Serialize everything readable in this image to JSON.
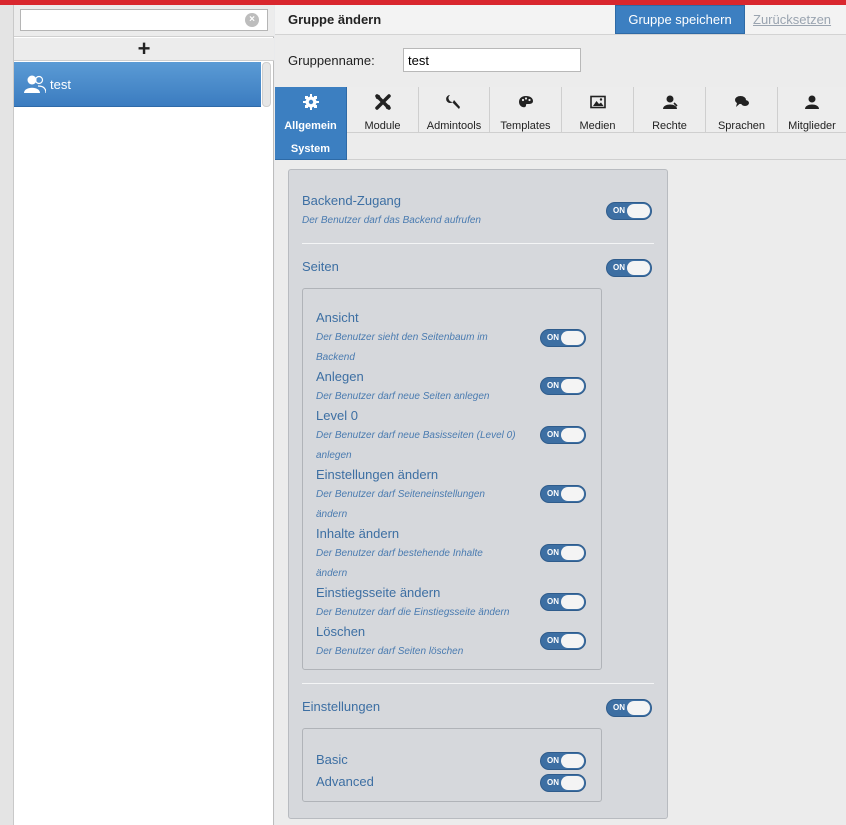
{
  "sidebar": {
    "search": {
      "value": "",
      "placeholder": ""
    },
    "add_label": "+",
    "groups": [
      {
        "label": "test"
      }
    ]
  },
  "header": {
    "title": "Gruppe ändern",
    "save_label": "Gruppe speichern",
    "reset_label": "Zurücksetzen"
  },
  "form": {
    "name_label": "Gruppenname:",
    "name_value": "test"
  },
  "tabs": [
    {
      "label": "Allgemein",
      "label2": "System",
      "icon": "gear-icon"
    },
    {
      "label": "Module",
      "icon": "puzzle-icon"
    },
    {
      "label": "Admintools",
      "icon": "wrench-icon"
    },
    {
      "label": "Templates",
      "icon": "palette-icon"
    },
    {
      "label": "Medien",
      "icon": "image-icon"
    },
    {
      "label": "Rechte",
      "icon": "user-rights-icon"
    },
    {
      "label": "Sprachen",
      "icon": "speech-bubbles-icon"
    },
    {
      "label": "Mitglieder",
      "icon": "user-icon"
    }
  ],
  "toggle_text": "ON",
  "permissions": {
    "backend": {
      "title": "Backend-Zugang",
      "desc": "Der Benutzer darf das Backend aufrufen"
    },
    "pages": {
      "title": "Seiten",
      "items": [
        {
          "title": "Ansicht",
          "desc1": "Der Benutzer sieht den Seitenbaum im",
          "desc2": "Backend"
        },
        {
          "title": "Anlegen",
          "desc1": "Der Benutzer darf neue Seiten anlegen",
          "desc2": ""
        },
        {
          "title": "Level 0",
          "desc1": "Der Benutzer darf neue Basisseiten (Level 0)",
          "desc2": "anlegen"
        },
        {
          "title": "Einstellungen ändern",
          "desc1": "Der Benutzer darf Seiteneinstellungen",
          "desc2": "ändern"
        },
        {
          "title": "Inhalte ändern",
          "desc1": "Der Benutzer darf bestehende Inhalte",
          "desc2": "ändern"
        },
        {
          "title": "Einstiegsseite ändern",
          "desc1": "Der Benutzer darf die Einstiegsseite ändern",
          "desc2": ""
        },
        {
          "title": "Löschen",
          "desc1": "Der Benutzer darf Seiten löschen",
          "desc2": ""
        }
      ]
    },
    "settings": {
      "title": "Einstellungen",
      "items": [
        {
          "title": "Basic"
        },
        {
          "title": "Advanced"
        }
      ]
    }
  }
}
